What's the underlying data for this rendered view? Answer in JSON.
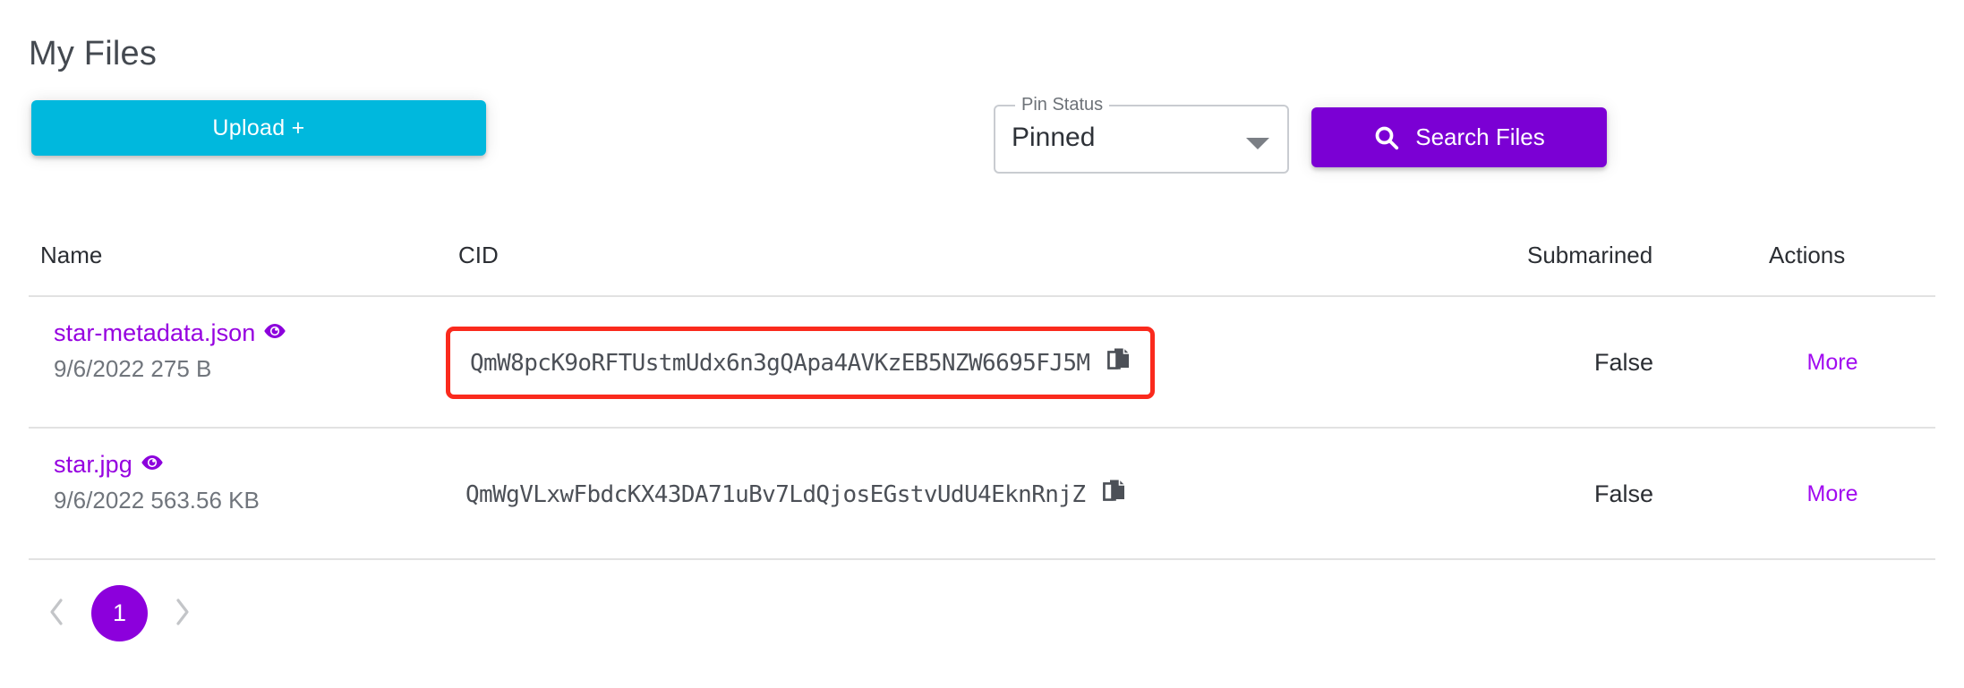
{
  "page": {
    "title": "My Files"
  },
  "toolbar": {
    "upload_label": "Upload +",
    "pin_status": {
      "legend": "Pin Status",
      "value": "Pinned",
      "caret_icon": "chevron-down-icon"
    },
    "search": {
      "label": "Search Files",
      "icon": "search-icon"
    }
  },
  "colors": {
    "upload_cyan": "#00b8dd",
    "brand_purple": "#7b00d4",
    "link_purple": "#9602e0",
    "highlight_red": "#fa2a1d",
    "divider_gray": "#e2e2e2"
  },
  "table": {
    "columns": [
      {
        "key": "name",
        "label": "Name"
      },
      {
        "key": "cid",
        "label": "CID"
      },
      {
        "key": "submarined",
        "label": "Submarined"
      },
      {
        "key": "actions",
        "label": "Actions"
      }
    ],
    "rows": [
      {
        "name": "star-metadata.json",
        "preview_icon": "eye-icon",
        "date": "9/6/2022",
        "size": "275 B",
        "meta": "9/6/2022 275 B",
        "cid": "QmW8pcK9oRFTUstmUdx6n3gQApa4AVKzEB5NZW6695FJ5M",
        "copy_icon": "copy-icon",
        "cid_highlighted": true,
        "submarined": "False",
        "action_label": "More"
      },
      {
        "name": "star.jpg",
        "preview_icon": "eye-icon",
        "date": "9/6/2022",
        "size": "563.56 KB",
        "meta": "9/6/2022 563.56 KB",
        "cid": "QmWgVLxwFbdcKX43DA71uBv7LdQjosEGstvUdU4EknRnjZ",
        "copy_icon": "copy-icon",
        "cid_highlighted": false,
        "submarined": "False",
        "action_label": "More"
      }
    ]
  },
  "pagination": {
    "prev_icon": "chevron-left-icon",
    "next_icon": "chevron-right-icon",
    "current_page": "1"
  }
}
